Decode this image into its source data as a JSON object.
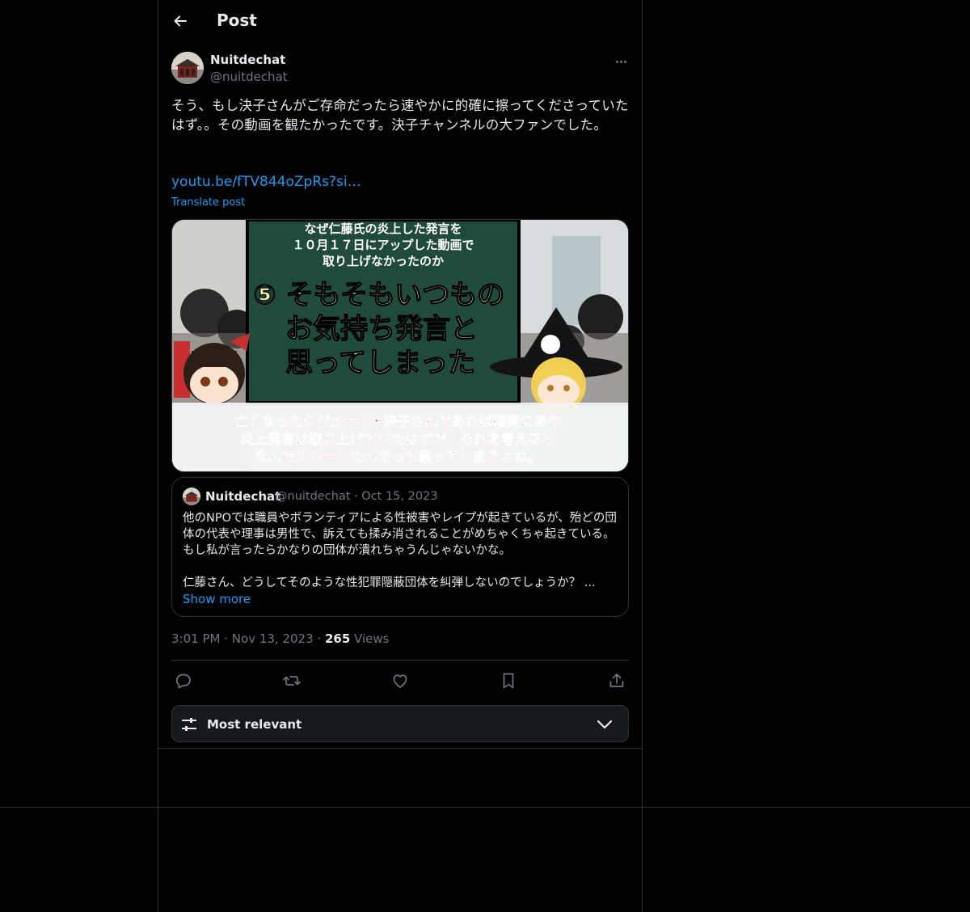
{
  "header": {
    "title": "Post"
  },
  "post": {
    "author_name": "Nuitdechat",
    "author_handle": "@nuitdechat",
    "text": "そう、もし決子さんがご存命だったら速やかに的確に擦ってくださっていたはず。。その動画を観たかったです。決子チャンネルの大ファンでした。",
    "link": "youtu.be/fTV844oZpRs?si…",
    "translate_label": "Translate post",
    "media": {
      "board_lines": [
        "なぜ仁藤氏の炎上した発言を",
        "１０月１７日にアップした動画で",
        "取り上げなかったのか"
      ],
      "big_lines": [
        "⑤ そもそもいつもの",
        "お気持ち発言と",
        "思ってしまった"
      ],
      "caption_lines": [
        "亡くなったクジューノ・決子さんであれば確実にあの",
        "炎上発言は取り上げていたはずで、それを考えると",
        "なんでスルーしたんだって思ってしまうよね。"
      ]
    },
    "quote": {
      "author_name": "Nuitdechat",
      "author_handle": "@nuitdechat",
      "date": "Oct 15, 2023",
      "paragraphs": [
        "他のNPOでは職員やボランティアによる性被害やレイプが起きているが、殆どの団体の代表や理事は男性で、訴えても揉み消されることがめちゃくちゃ起きている。もし私が言ったらかなりの団体が潰れちゃうんじゃないかな。",
        "仁藤さん、どうしてそのような性犯罪隠蔽団体を糾弾しないのでしょうか？ ..."
      ],
      "show_more": "Show more"
    },
    "time": "3:01 PM",
    "date": "Nov 13, 2023",
    "views_count": "265",
    "views_label": "Views"
  },
  "sort": {
    "label": "Most relevant"
  },
  "icons": {
    "back": "arrow-left-icon",
    "more": "more-horizontal-icon",
    "reply": "reply-icon",
    "repost": "repost-icon",
    "like": "heart-icon",
    "bookmark": "bookmark-icon",
    "share": "share-icon",
    "sort": "sliders-icon",
    "chevron": "chevron-down-icon"
  },
  "colors": {
    "background": "#000000",
    "text": "#e7e9ea",
    "secondary": "#71767b",
    "accent": "#1d9bf0",
    "border": "#2f3336",
    "caption_pink": "#e8359c",
    "board_green": "#1f4a3c"
  }
}
